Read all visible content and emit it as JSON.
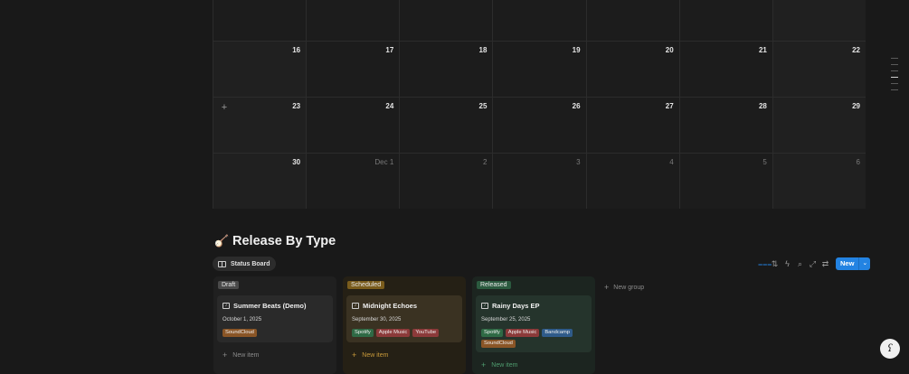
{
  "calendar": {
    "weeks": [
      {
        "days": [
          "",
          "",
          "",
          "",
          "",
          "",
          ""
        ],
        "muted": [
          false,
          false,
          false,
          false,
          false,
          false,
          false
        ]
      },
      {
        "days": [
          "16",
          "17",
          "18",
          "19",
          "20",
          "21",
          "22"
        ],
        "muted": [
          false,
          false,
          false,
          false,
          false,
          false,
          false
        ]
      },
      {
        "days": [
          "23",
          "24",
          "25",
          "26",
          "27",
          "28",
          "29"
        ],
        "muted": [
          false,
          false,
          false,
          false,
          false,
          false,
          false
        ]
      },
      {
        "days": [
          "30",
          "Dec 1",
          "2",
          "3",
          "4",
          "5",
          "6"
        ],
        "muted": [
          false,
          true,
          true,
          true,
          true,
          true,
          true
        ]
      }
    ],
    "add_icon": "+"
  },
  "section": {
    "emoji": "🪕",
    "title": "Release By Type",
    "view_tab": "Status Board"
  },
  "toolbar": {
    "icons": [
      "filter-icon",
      "sort-icon",
      "lightning-icon",
      "search-icon",
      "expand-icon",
      "settings-icon"
    ],
    "glyphs": [
      "⩶",
      "⇅",
      "ϟ",
      "⌕",
      "⤢",
      "⇄"
    ],
    "new_label": "New",
    "new_dropdown": "⌄"
  },
  "board": {
    "groups": [
      {
        "label": "Draft",
        "card": {
          "title": "Summer Beats (Demo)",
          "date": "October 1, 2025",
          "tags": [
            "SoundCloud"
          ]
        },
        "new_item": "New item"
      },
      {
        "label": "Scheduled",
        "card": {
          "title": "Midnight Echoes",
          "date": "September 30, 2025",
          "tags": [
            "Spotify",
            "Apple Music",
            "YouTube"
          ]
        },
        "new_item": "New item"
      },
      {
        "label": "Released",
        "card": {
          "title": "Rainy Days EP",
          "date": "September 25, 2025",
          "tags": [
            "Spotify",
            "Apple Music",
            "Bandcamp",
            "SoundCloud"
          ]
        },
        "new_item": "New item"
      }
    ],
    "new_group": "New group"
  },
  "help": {
    "glyph": "ʕ"
  }
}
